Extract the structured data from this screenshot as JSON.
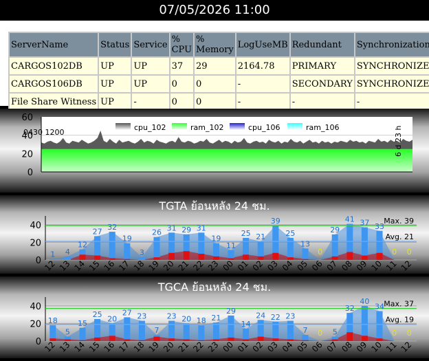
{
  "header": {
    "datetime": "07/05/2026 11:00"
  },
  "server_table": {
    "columns": [
      "ServerName",
      "Status",
      "Service",
      "% CPU",
      "% Memory",
      "LogUseMB",
      "Redundant",
      "Synchronization"
    ],
    "rows": [
      [
        "CARGOS102DB",
        "UP",
        "UP",
        "37",
        "29",
        "2164.78",
        "PRIMARY",
        "SYNCHRONIZED"
      ],
      [
        "CARGOS106DB",
        "UP",
        "UP",
        "0",
        "0",
        "-",
        "SECONDARY",
        "SYNCHRONIZED"
      ],
      [
        "File Share Witness",
        "UP",
        "-",
        "0",
        "0",
        "-",
        "-",
        "-"
      ]
    ]
  },
  "cpu_chart": {
    "overlay_label": "0430 1200",
    "uptime_label": "6 d 23 h",
    "legend": [
      {
        "label": "cpu_102",
        "color": "#555555"
      },
      {
        "label": "ram_102",
        "color": "#33ff33"
      },
      {
        "label": "cpu_106",
        "color": "#2222cc"
      },
      {
        "label": "ram_106",
        "color": "#33ffff"
      }
    ]
  },
  "colors": {
    "bar": "#3f96f0",
    "area": "#4a90d9",
    "red_bar": "#dd1111",
    "red_area": "#cc0000",
    "max_line": "#33cc33",
    "avg_line": "#66aaff",
    "header_bg": "#7d8e9c",
    "cell_bg": "#ffffe0",
    "zero_label": "#e8e800"
  },
  "chart_data": [
    {
      "type": "area",
      "series": [
        {
          "name": "cpu_102",
          "values": [
            32,
            31,
            33,
            34,
            32,
            31,
            33,
            37,
            32,
            31,
            34,
            33,
            32,
            35,
            33,
            31,
            32,
            34,
            37,
            45,
            34,
            32,
            36,
            33,
            31,
            35,
            32,
            33,
            34,
            32,
            31,
            33,
            36,
            32,
            34,
            33,
            31,
            35,
            33,
            32,
            31,
            33,
            34,
            32,
            38,
            33,
            32,
            34,
            33,
            31,
            32,
            34,
            33,
            36,
            32,
            31,
            33,
            35,
            32,
            34,
            33,
            31,
            34,
            32,
            33,
            37,
            32,
            31,
            33,
            34,
            32,
            33,
            31,
            35,
            33,
            32,
            34,
            31,
            33,
            32,
            36,
            33,
            32,
            34,
            31,
            33,
            35,
            32,
            33,
            31,
            34,
            32,
            33,
            31,
            33,
            32,
            34,
            33,
            32,
            35,
            33,
            34,
            32,
            33,
            31,
            34,
            33,
            32,
            36,
            33,
            34,
            32,
            35,
            33,
            34,
            32,
            36,
            34,
            33,
            35
          ]
        },
        {
          "name": "ram_102",
          "values": [
            25
          ]
        },
        {
          "name": "cpu_106",
          "values": [
            0
          ]
        },
        {
          "name": "ram_106",
          "values": [
            0
          ]
        }
      ],
      "ylim": [
        0,
        60
      ],
      "yticks": [
        0,
        20,
        40,
        60
      ],
      "grid": true,
      "legend_placement": "top"
    },
    {
      "type": "bar",
      "title": "TGTA ย้อนหลัง 24 ชม.",
      "categories": [
        "12",
        "13",
        "14",
        "15",
        "16",
        "17",
        "18",
        "19",
        "20",
        "21",
        "22",
        "23",
        "00",
        "01",
        "02",
        "03",
        "04",
        "05",
        "06",
        "07",
        "08",
        "09",
        "10",
        "11",
        "12"
      ],
      "series": [
        {
          "values": [
            1,
            4,
            12,
            27,
            32,
            19,
            3,
            26,
            31,
            29,
            31,
            19,
            11,
            25,
            21,
            39,
            25,
            13,
            0,
            29,
            41,
            37,
            33,
            0,
            0
          ]
        },
        {
          "values": [
            0,
            0,
            6,
            5,
            2,
            1,
            0,
            3,
            8,
            10,
            7,
            4,
            2,
            6,
            4,
            8,
            3,
            1,
            0,
            4,
            9,
            5,
            8,
            0,
            0
          ]
        }
      ],
      "max": 39,
      "avg": 21,
      "max_label": "Max. 39",
      "avg_label": "Avg. 21",
      "ylim": [
        0,
        50
      ],
      "yticks": [
        0,
        20,
        40
      ],
      "grid": true
    },
    {
      "type": "bar",
      "title": "TGCA ย้อนหลัง 24 ชม.",
      "categories": [
        "12",
        "13",
        "14",
        "15",
        "16",
        "17",
        "18",
        "19",
        "20",
        "21",
        "22",
        "23",
        "00",
        "01",
        "02",
        "03",
        "04",
        "05",
        "06",
        "07",
        "08",
        "09",
        "10",
        "11",
        "12"
      ],
      "series": [
        {
          "values": [
            18,
            5,
            15,
            25,
            20,
            27,
            23,
            7,
            23,
            20,
            18,
            21,
            29,
            14,
            24,
            22,
            23,
            7,
            0,
            5,
            32,
            40,
            34,
            0,
            0
          ]
        },
        {
          "values": [
            3,
            2,
            1,
            4,
            6,
            2,
            1,
            5,
            3,
            2,
            1,
            2,
            4,
            2,
            5,
            3,
            2,
            1,
            0,
            2,
            10,
            6,
            3,
            0,
            0
          ]
        }
      ],
      "max": 37,
      "avg": 19,
      "max_label": "Max. 37",
      "avg_label": "Avg. 19",
      "ylim": [
        0,
        50
      ],
      "yticks": [
        0,
        20,
        40
      ],
      "grid": true
    }
  ]
}
